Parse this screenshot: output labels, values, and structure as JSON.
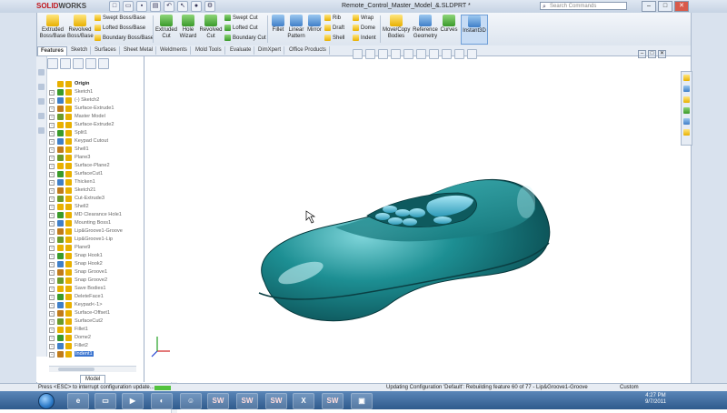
{
  "app": {
    "logo_red": "SOLID",
    "logo_rest": "WORKS",
    "document_title": "Remote_Control_Master_Model_&.SLDPRT *",
    "search_placeholder": "Search Commands"
  },
  "ribbon": {
    "extruded_boss": "Extruded Boss/Base",
    "revolved_boss": "Revolved Boss/Base",
    "swept_boss": "Swept Boss/Base",
    "lofted_boss": "Lofted Boss/Base",
    "boundary_boss": "Boundary Boss/Base",
    "extruded_cut": "Extruded Cut",
    "hole_wizard": "Hole Wizard",
    "revolved_cut": "Revolved Cut",
    "swept_cut": "Swept Cut",
    "lofted_cut": "Lofted Cut",
    "boundary_cut": "Boundary Cut",
    "fillet": "Fillet",
    "linear_pattern": "Linear Pattern",
    "mirror": "Mirror",
    "rib": "Rib",
    "draft": "Draft",
    "shell": "Shell",
    "wrap": "Wrap",
    "dome": "Dome",
    "indent": "Indent",
    "move_copy": "Move/Copy Bodies",
    "reference_geometry": "Reference Geometry",
    "curves": "Curves",
    "instant3d": "Instant3D"
  },
  "tabs": [
    "Features",
    "Sketch",
    "Surfaces",
    "Sheet Metal",
    "Weldments",
    "Mold Tools",
    "Evaluate",
    "DimXpert",
    "Office Products"
  ],
  "feature_tree": {
    "items": [
      "Origin",
      "Sketch1",
      "(-) Sketch2",
      "Surface-Extrude1",
      "Master Model",
      "Surface-Extrude2",
      "Split1",
      "Keypad Cutout",
      "Shell1",
      "Plane3",
      "Surface-Plane2",
      "SurfaceCut1",
      "Thicken1",
      "Sketch21",
      "Cut-Extrude3",
      "Shell2",
      "MD Clearance Hole1",
      "Mounting Boss1",
      "Lip&Groove1-Groove",
      "Lip&Groove1-Lip",
      "Plane9",
      "Snap Hook1",
      "Snap Hook2",
      "Snap Groove1",
      "Snap Groove2",
      "Save Bodies1",
      "DeleteFace1",
      "Keypad<-1>",
      "Surface-Offset1",
      "SurfaceCut2",
      "Fillet1",
      "Dome2",
      "Fillet2",
      "Indent1"
    ]
  },
  "model_tab": "Model",
  "status": {
    "left": "Press <ESC> to interrupt configuration update...",
    "progress": 0.06,
    "middle": "Updating Configuration 'Default': Rebuilding feature 60 of 77 - Lip&Groove1-Groove",
    "right": "Custom"
  },
  "taskbar": {
    "time": "4:27 PM",
    "date": "9/7/2011",
    "sw_label": "SW"
  },
  "colors": {
    "model_teal": "#1d8f93",
    "model_highlight": "#7fd5da",
    "selection_blue": "#3a74d0"
  }
}
